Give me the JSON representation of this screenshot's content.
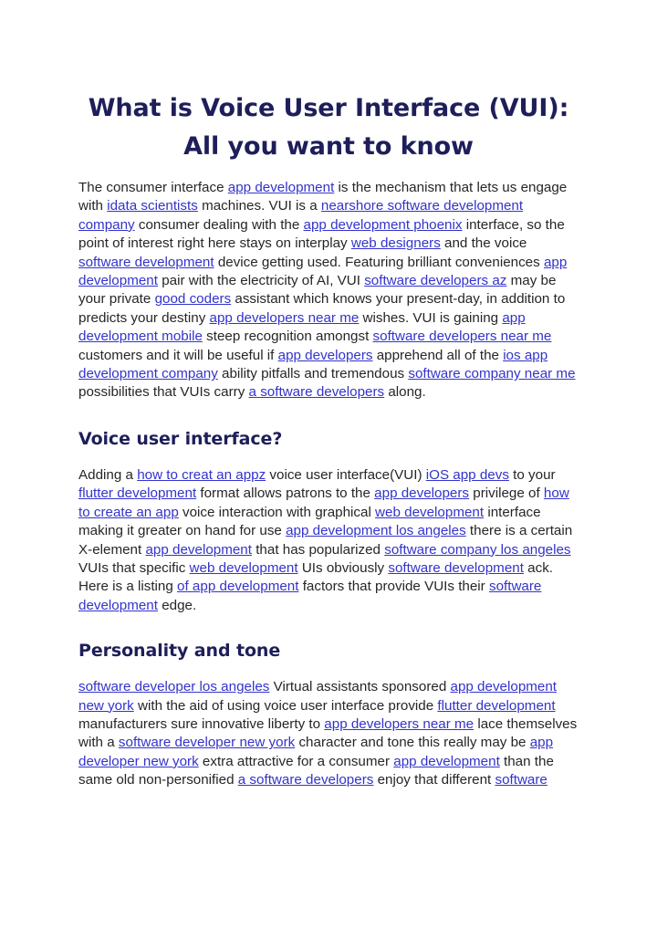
{
  "document": {
    "title": "What is Voice User Interface (VUI): All you want to know",
    "colors": {
      "heading": "#1e1e5a",
      "body_text": "#262626",
      "link": "#3333cc",
      "background": "#ffffff"
    },
    "sections": [
      {
        "heading": null,
        "paragraph_runs": [
          {
            "t": "The consumer interface ",
            "link": false
          },
          {
            "t": "app development",
            "link": true
          },
          {
            "t": " is the mechanism that lets us engage with ",
            "link": false
          },
          {
            "t": "idata scientists",
            "link": true
          },
          {
            "t": " machines. VUI is a ",
            "link": false
          },
          {
            "t": "nearshore software development company",
            "link": true
          },
          {
            "t": " consumer dealing with the ",
            "link": false
          },
          {
            "t": "app development phoenix",
            "link": true
          },
          {
            "t": " interface, so the point of interest right here stays on interplay ",
            "link": false
          },
          {
            "t": "web designers",
            "link": true
          },
          {
            "t": " and the voice ",
            "link": false
          },
          {
            "t": "software development",
            "link": true
          },
          {
            "t": " device getting used. Featuring brilliant conveniences ",
            "link": false
          },
          {
            "t": "app development",
            "link": true
          },
          {
            "t": " pair with the electricity of AI, VUI ",
            "link": false
          },
          {
            "t": "software developers az",
            "link": true
          },
          {
            "t": " may be your private ",
            "link": false
          },
          {
            "t": "good coders",
            "link": true
          },
          {
            "t": " assistant which knows your present-day, in addition to predicts your destiny ",
            "link": false
          },
          {
            "t": "app developers near me",
            "link": true
          },
          {
            "t": " wishes. VUI is gaining ",
            "link": false
          },
          {
            "t": "app development mobile",
            "link": true
          },
          {
            "t": " steep recognition amongst ",
            "link": false
          },
          {
            "t": "software developers near me",
            "link": true
          },
          {
            "t": " customers and it will be useful if ",
            "link": false
          },
          {
            "t": "app developers",
            "link": true
          },
          {
            "t": " apprehend all of the ",
            "link": false
          },
          {
            "t": "ios app development company",
            "link": true
          },
          {
            "t": " ability pitfalls and tremendous ",
            "link": false
          },
          {
            "t": "software company near me",
            "link": true
          },
          {
            "t": " possibilities that VUIs carry ",
            "link": false
          },
          {
            "t": "a software developers",
            "link": true
          },
          {
            "t": " along.",
            "link": false
          }
        ]
      },
      {
        "heading": "Voice user interface?",
        "paragraph_runs": [
          {
            "t": "Adding a ",
            "link": false
          },
          {
            "t": "how to creat an appz",
            "link": true
          },
          {
            "t": " voice user interface(VUI) ",
            "link": false
          },
          {
            "t": "iOS app devs",
            "link": true
          },
          {
            "t": " to your ",
            "link": false
          },
          {
            "t": "flutter development",
            "link": true
          },
          {
            "t": " format allows patrons to the ",
            "link": false
          },
          {
            "t": "app developers",
            "link": true
          },
          {
            "t": " privilege of ",
            "link": false
          },
          {
            "t": "how to create an app",
            "link": true
          },
          {
            "t": " voice interaction with graphical ",
            "link": false
          },
          {
            "t": "web development",
            "link": true
          },
          {
            "t": " interface making it greater on hand for use ",
            "link": false
          },
          {
            "t": "app development los angeles",
            "link": true
          },
          {
            "t": " there is a certain X-element ",
            "link": false
          },
          {
            "t": "app development",
            "link": true
          },
          {
            "t": " that has popularized ",
            "link": false
          },
          {
            "t": "software company los angeles",
            "link": true
          },
          {
            "t": " VUIs that specific ",
            "link": false
          },
          {
            "t": "web development",
            "link": true
          },
          {
            "t": " UIs obviously ",
            "link": false
          },
          {
            "t": "software development",
            "link": true
          },
          {
            "t": " ack. Here is a listing ",
            "link": false
          },
          {
            "t": "of app development",
            "link": true
          },
          {
            "t": " factors that provide VUIs their ",
            "link": false
          },
          {
            "t": "software development",
            "link": true
          },
          {
            "t": " edge.",
            "link": false
          }
        ]
      },
      {
        "heading": "Personality and tone",
        "paragraph_runs": [
          {
            "t": "software developer los angeles",
            "link": true
          },
          {
            "t": " Virtual assistants sponsored ",
            "link": false
          },
          {
            "t": "app development new york",
            "link": true
          },
          {
            "t": " with the aid of using voice user interface provide ",
            "link": false
          },
          {
            "t": "flutter development",
            "link": true
          },
          {
            "t": " manufacturers sure innovative liberty to ",
            "link": false
          },
          {
            "t": "app developers near me",
            "link": true
          },
          {
            "t": " lace themselves with a ",
            "link": false
          },
          {
            "t": "software developer new york",
            "link": true
          },
          {
            "t": " character and tone this really may be ",
            "link": false
          },
          {
            "t": "app developer new york",
            "link": true
          },
          {
            "t": " extra attractive for a consumer ",
            "link": false
          },
          {
            "t": "app development",
            "link": true
          },
          {
            "t": " than the same old non-personified ",
            "link": false
          },
          {
            "t": "a software developers",
            "link": true
          },
          {
            "t": " enjoy that different ",
            "link": false
          },
          {
            "t": "software",
            "link": true
          }
        ]
      }
    ]
  }
}
